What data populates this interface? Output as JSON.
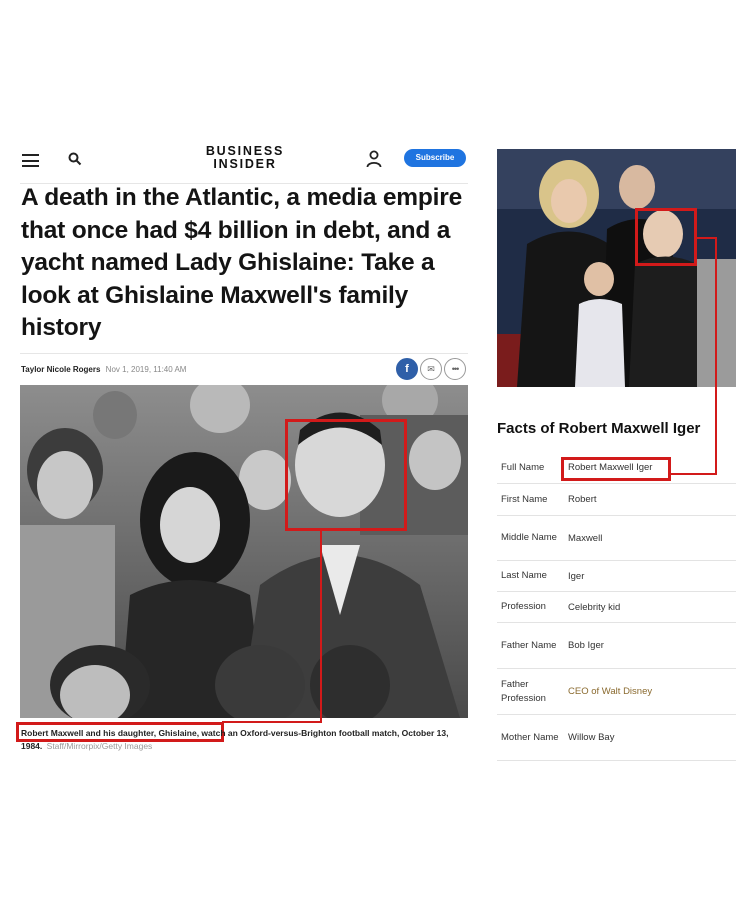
{
  "article": {
    "publication_line1": "BUSINESS",
    "publication_line2": "INSIDER",
    "subscribe_label": "Subscribe",
    "headline": "A death in the Atlantic, a media empire that once had $4 billion in debt, and a yacht named Lady Ghislaine: Take a look at Ghislaine Maxwell's family history",
    "author": "Taylor Nicole Rogers",
    "date": "Nov 1, 2019, 11:40 AM",
    "share_facebook": "f",
    "share_email": "✉",
    "share_more": "•••",
    "caption": "Robert Maxwell and his daughter, Ghislaine, watch an Oxford-versus-Brighton football match, October 13, 1984.",
    "caption_credit": "Staff/Mirrorpix/Getty Images"
  },
  "facts": {
    "title": "Facts of Robert Maxwell Iger",
    "rows": [
      {
        "key": "Full Name",
        "value": "Robert Maxwell Iger"
      },
      {
        "key": "First Name",
        "value": "Robert"
      },
      {
        "key": "Middle Name",
        "value": "Maxwell"
      },
      {
        "key": "Last Name",
        "value": "Iger"
      },
      {
        "key": "Profession",
        "value": "Celebrity kid"
      },
      {
        "key": "Father Name",
        "value": "Bob Iger"
      },
      {
        "key": "Father Profession",
        "value": "CEO of Walt Disney"
      },
      {
        "key": "Mother Name",
        "value": "Willow Bay"
      }
    ]
  },
  "colors": {
    "highlight": "#d21a1a",
    "subscribe_bg": "#1f74e0",
    "link": "#8a6a2f"
  },
  "icons": [
    "menu-icon",
    "search-icon",
    "user-icon",
    "facebook-icon",
    "email-icon",
    "more-icon"
  ]
}
